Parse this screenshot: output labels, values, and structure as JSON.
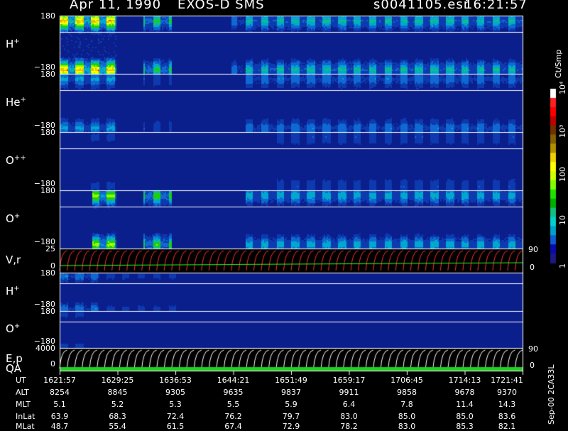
{
  "header": {
    "date": "Apr 11, 1990",
    "instrument": "EXOS-D SMS",
    "file": "s0041105.esr",
    "time": "16:21:57"
  },
  "chart_data": {
    "type": "heatmap",
    "colorbar": {
      "label": "Ct/Smp",
      "ticks": [
        "1",
        "10",
        "100",
        "10³",
        "10⁴"
      ],
      "colors": [
        "#1a1a80",
        "#0a0ab0",
        "#0e5ad0",
        "#00a0c8",
        "#00d0d0",
        "#10c080",
        "#00b000",
        "#20e000",
        "#80ff00",
        "#d0ff00",
        "#ffff00",
        "#f0d000",
        "#b09000",
        "#806000",
        "#703000",
        "#c00000",
        "#ff0000",
        "#ff2020",
        "#ffffff"
      ]
    },
    "time_axis": {
      "labels": [
        "1621:57",
        "1629:25",
        "1636:53",
        "1644:21",
        "1651:49",
        "1659:17",
        "1706:45",
        "1714:13",
        "1721:41"
      ]
    },
    "panels": [
      {
        "label": "H",
        "sup": "+",
        "top_tick": "180",
        "bottom_tick": "−180",
        "activity": [
          [
            0.0,
            0.12,
            0.9
          ],
          [
            0.18,
            0.24,
            0.55
          ],
          [
            0.37,
            0.4,
            0.3
          ],
          [
            0.4,
            1.0,
            0.45
          ]
        ]
      },
      {
        "label": "He",
        "sup": "+",
        "top_tick": "180",
        "bottom_tick": "−180",
        "activity": [
          [
            0.0,
            0.12,
            0.35
          ],
          [
            0.18,
            0.24,
            0.2
          ],
          [
            0.4,
            1.0,
            0.3
          ]
        ]
      },
      {
        "label": "O",
        "sup": "++",
        "top_tick": "180",
        "bottom_tick": "−180",
        "activity": [
          [
            0.05,
            0.12,
            0.15
          ],
          [
            0.45,
            1.0,
            0.2
          ]
        ]
      },
      {
        "label": "O",
        "sup": "+",
        "top_tick": "180",
        "bottom_tick": "−180",
        "activity": [
          [
            0.07,
            0.12,
            0.7
          ],
          [
            0.18,
            0.24,
            0.6
          ],
          [
            0.4,
            1.0,
            0.4
          ]
        ]
      },
      {
        "label": "V,r",
        "sup": "",
        "top_tick": "25",
        "bottom_tick": "0",
        "right_top": "90",
        "right_bottom": "0"
      },
      {
        "label": "H",
        "sup": "+",
        "top_tick": "180",
        "bottom_tick": "−180",
        "activity": [
          [
            0.0,
            0.08,
            0.3
          ],
          [
            0.08,
            0.25,
            0.15
          ],
          [
            0.25,
            1.0,
            0.08
          ]
        ]
      },
      {
        "label": "O",
        "sup": "+",
        "top_tick": "180",
        "bottom_tick": "−180",
        "activity": [
          [
            0.0,
            0.05,
            0.15
          ],
          [
            0.05,
            1.0,
            0.02
          ]
        ]
      },
      {
        "label": "E,p",
        "sup": "",
        "top_tick": "4000",
        "bottom_tick": "0",
        "right_top": "90",
        "right_bottom": "0"
      }
    ],
    "qa_label": "QA"
  },
  "ephemeris": {
    "rows": [
      {
        "name": "UT",
        "values": [
          "1621:57",
          "1629:25",
          "1636:53",
          "1644:21",
          "1651:49",
          "1659:17",
          "1706:45",
          "1714:13",
          "1721:41"
        ]
      },
      {
        "name": "ALT",
        "values": [
          "8254",
          "8845",
          "9305",
          "9635",
          "9837",
          "9911",
          "9858",
          "9678",
          "9370"
        ]
      },
      {
        "name": "MLT",
        "values": [
          "5.1",
          "5.2",
          "5.3",
          "5.5",
          "5.9",
          "6.4",
          "7.8",
          "11.4",
          "14.3"
        ]
      },
      {
        "name": "InLat",
        "values": [
          "63.9",
          "68.3",
          "72.4",
          "76.2",
          "79.7",
          "83.0",
          "85.0",
          "85.0",
          "83.6"
        ]
      },
      {
        "name": "MLat",
        "values": [
          "48.7",
          "55.4",
          "61.5",
          "67.4",
          "72.9",
          "78.2",
          "83.0",
          "85.3",
          "82.1"
        ]
      }
    ]
  },
  "footer": {
    "version": "Sep-00  2CA33L"
  }
}
